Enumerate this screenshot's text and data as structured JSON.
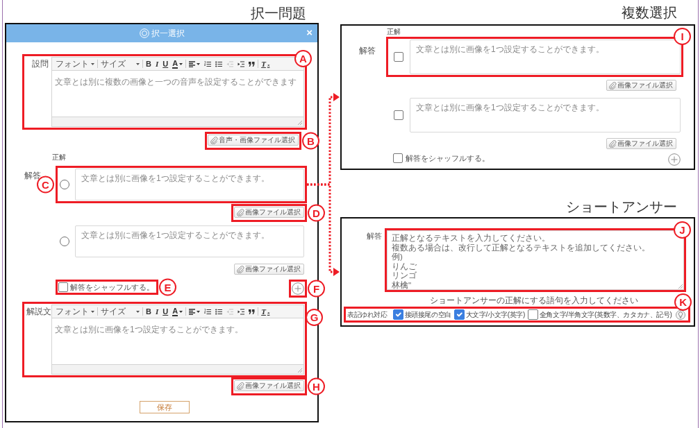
{
  "single_choice": {
    "heading": "択一問題",
    "dialog": {
      "title": "択一選択",
      "close": "×",
      "question": {
        "label": "設問",
        "callout": "A",
        "toolbar": [
          [
            {
              "kind": "dropdown",
              "label": "フォント",
              "disabled": false
            }
          ],
          [
            {
              "kind": "dropdown",
              "label": "サイズ",
              "disabled": false
            }
          ],
          [
            {
              "kind": "bold",
              "label": "B",
              "disabled": false
            },
            {
              "kind": "italic",
              "label": "I",
              "disabled": false
            },
            {
              "kind": "underline",
              "label": "U",
              "disabled": false
            },
            {
              "kind": "font-color",
              "label": "A",
              "disabled": false
            }
          ],
          [
            {
              "kind": "align",
              "disabled": false
            },
            {
              "kind": "numbered-list",
              "disabled": false
            },
            {
              "kind": "bullet-list",
              "disabled": false
            },
            {
              "kind": "outdent",
              "disabled": true
            },
            {
              "kind": "indent",
              "disabled": false
            },
            {
              "kind": "blockquote",
              "disabled": false
            }
          ],
          [
            {
              "kind": "remove-format",
              "label": "T$_{x}$",
              "disabled": false
            }
          ]
        ],
        "placeholder": "文章とは別に複数の画像と一つの音声を設定することができます",
        "file_button": "音声・画像ファイル選択",
        "file_callout": "B"
      },
      "answers": {
        "correct_label": "正解",
        "label": "解答",
        "items": [
          {
            "selected": false,
            "placeholder": "文章とは別に画像を1つ設定することができます。",
            "file_button": "画像ファイル選択",
            "callout": "C",
            "file_callout": "D"
          },
          {
            "selected": false,
            "placeholder": "文章とは別に画像を1つ設定することができます。",
            "file_button": "画像ファイル選択"
          }
        ],
        "shuffle": {
          "label": "解答をシャッフルする。",
          "checked": false,
          "callout": "E"
        },
        "add_callout": "F"
      },
      "explanation": {
        "label": "解説文",
        "callout": "G",
        "toolbar": [
          [
            {
              "kind": "dropdown",
              "label": "フォント",
              "disabled": false
            }
          ],
          [
            {
              "kind": "dropdown",
              "label": "サイズ",
              "disabled": false
            }
          ],
          [
            {
              "kind": "bold",
              "label": "B",
              "disabled": false
            },
            {
              "kind": "italic",
              "label": "I",
              "disabled": false
            },
            {
              "kind": "underline",
              "label": "U",
              "disabled": false
            },
            {
              "kind": "font-color",
              "label": "A",
              "disabled": false
            }
          ],
          [
            {
              "kind": "align",
              "disabled": false
            },
            {
              "kind": "numbered-list",
              "disabled": false
            },
            {
              "kind": "bullet-list",
              "disabled": false
            },
            {
              "kind": "outdent",
              "disabled": true
            },
            {
              "kind": "indent",
              "disabled": false
            },
            {
              "kind": "blockquote",
              "disabled": false
            }
          ],
          [
            {
              "kind": "remove-format",
              "label": "T$_{x}$",
              "disabled": false
            }
          ]
        ],
        "placeholder": "文章とは別に画像を1つ設定することができます。",
        "file_button": "画像ファイル選択",
        "file_callout": "H"
      },
      "save": "保存"
    }
  },
  "multiple_choice": {
    "heading": "複数選択",
    "correct_label": "正解",
    "label": "解答",
    "items": [
      {
        "checked": false,
        "placeholder": "文章とは別に画像を1つ設定することができます。",
        "file_button": "画像ファイル選択",
        "callout": "I"
      },
      {
        "checked": false,
        "placeholder": "文章とは別に画像を1つ設定することができます。",
        "file_button": "画像ファイル選択"
      }
    ],
    "shuffle": {
      "label": "解答をシャッフルする。",
      "checked": false
    }
  },
  "short_answer": {
    "heading": "ショートアンサー",
    "label": "解答",
    "placeholder": [
      "正解となるテキストを入力してください。",
      "複数ある場合は、改行して正解となるテキストを追加してください。",
      "例)",
      "りんご",
      "リンゴ",
      "林檎\""
    ],
    "callout": "J",
    "hint": "ショートアンサーの正解にする語句を入力してください",
    "variants": {
      "label": "表記ゆれ対応",
      "callout": "K",
      "options": [
        {
          "label": "接頭接尾の空白",
          "checked": true
        },
        {
          "label": "大文字/小文字(英字)",
          "checked": true
        },
        {
          "label": "全角文字/半角文字(英数字、カタカナ、記号)",
          "checked": false
        }
      ]
    }
  }
}
